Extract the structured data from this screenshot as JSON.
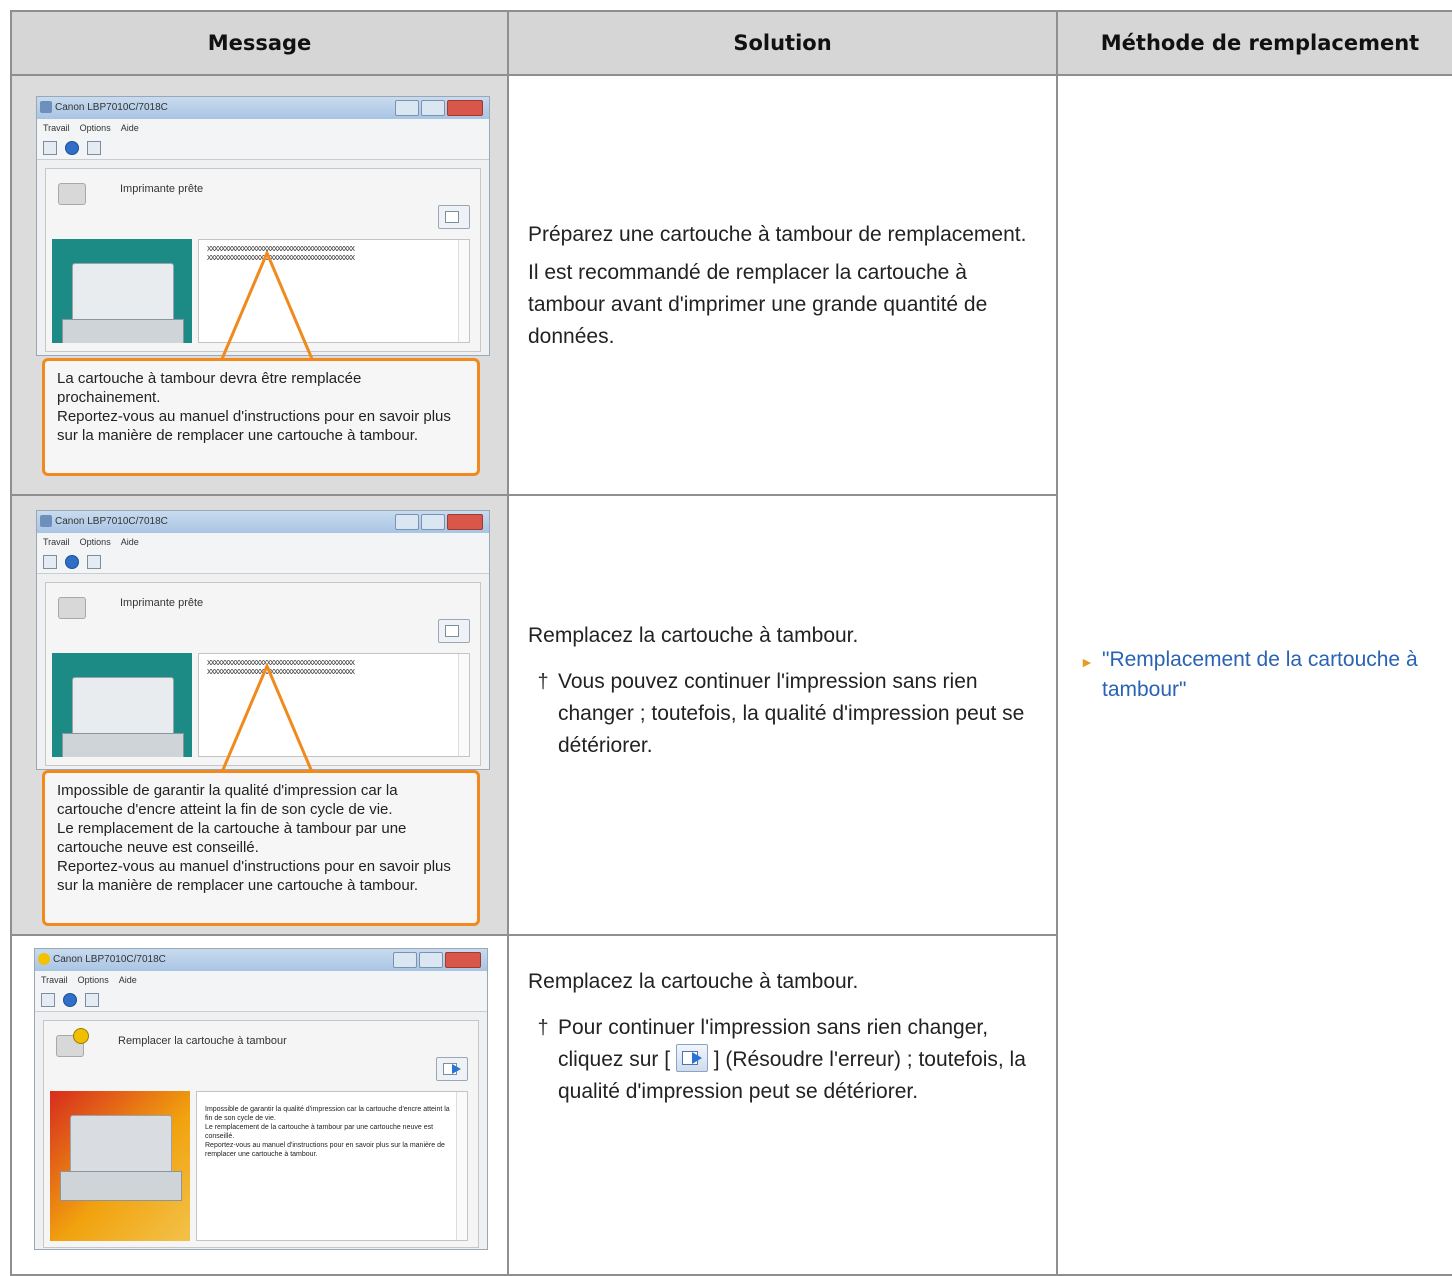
{
  "headers": {
    "message": "Message",
    "solution": "Solution",
    "replacement": "Méthode de remplacement"
  },
  "window": {
    "title": "Canon LBP7010C/7018C",
    "menu": [
      "Travail",
      "Options",
      "Aide"
    ]
  },
  "rows": [
    {
      "status": "Imprimante prête",
      "message_box_lines": [
        "xxxxxxxxxxxxxxxxxxxxxxxxxxxxxxxxxxxxxxxxxx",
        "xxxxxxxxxxxxxxxxxxxxxxxxxxxxxxxxxxxxxxxxxx"
      ],
      "callout": "La cartouche à tambour devra être remplacée prochainement.\nReportez-vous au manuel d'instructions pour en savoir plus sur la manière de remplacer une cartouche à tambour.",
      "solution_p1": "Préparez une cartouche à tambour de remplacement.",
      "solution_p2": "Il est recommandé de remplacer la cartouche à tambour avant d'imprimer une grande quantité de données."
    },
    {
      "status": "Imprimante prête",
      "message_box_lines": [
        "xxxxxxxxxxxxxxxxxxxxxxxxxxxxxxxxxxxxxxxxxx",
        "xxxxxxxxxxxxxxxxxxxxxxxxxxxxxxxxxxxxxxxxxx"
      ],
      "callout": "Impossible de garantir la qualité d'impression car la cartouche d'encre atteint la fin de son cycle de vie.\nLe remplacement de la cartouche à tambour par une cartouche neuve est conseillé.\nReportez-vous au manuel d'instructions pour en savoir plus sur la manière de remplacer une cartouche à tambour.",
      "solution_p1": "Remplacez la cartouche à tambour.",
      "note_marker": "†",
      "note": "Vous pouvez continuer l'impression sans rien changer ; toutefois, la qualité d'impression peut se détériorer."
    },
    {
      "status": "Remplacer la cartouche à tambour",
      "message_box_text": "Impossible de garantir la qualité d'impression car la cartouche d'encre atteint la fin de son cycle de vie.\nLe remplacement de la cartouche à tambour par une cartouche neuve est conseillé.\nReportez-vous au manuel d'instructions pour en savoir plus sur la manière de remplacer une cartouche à tambour.",
      "solution_p1": "Remplacez la cartouche à tambour.",
      "note_marker": "†",
      "note_before": "Pour continuer l'impression sans rien changer, cliquez sur [",
      "note_after": "] (Résoudre l'erreur) ; toutefois, la qualité d'impression peut se détériorer."
    }
  ],
  "replacement_link": "\"Remplacement de la cartouche à tambour\""
}
